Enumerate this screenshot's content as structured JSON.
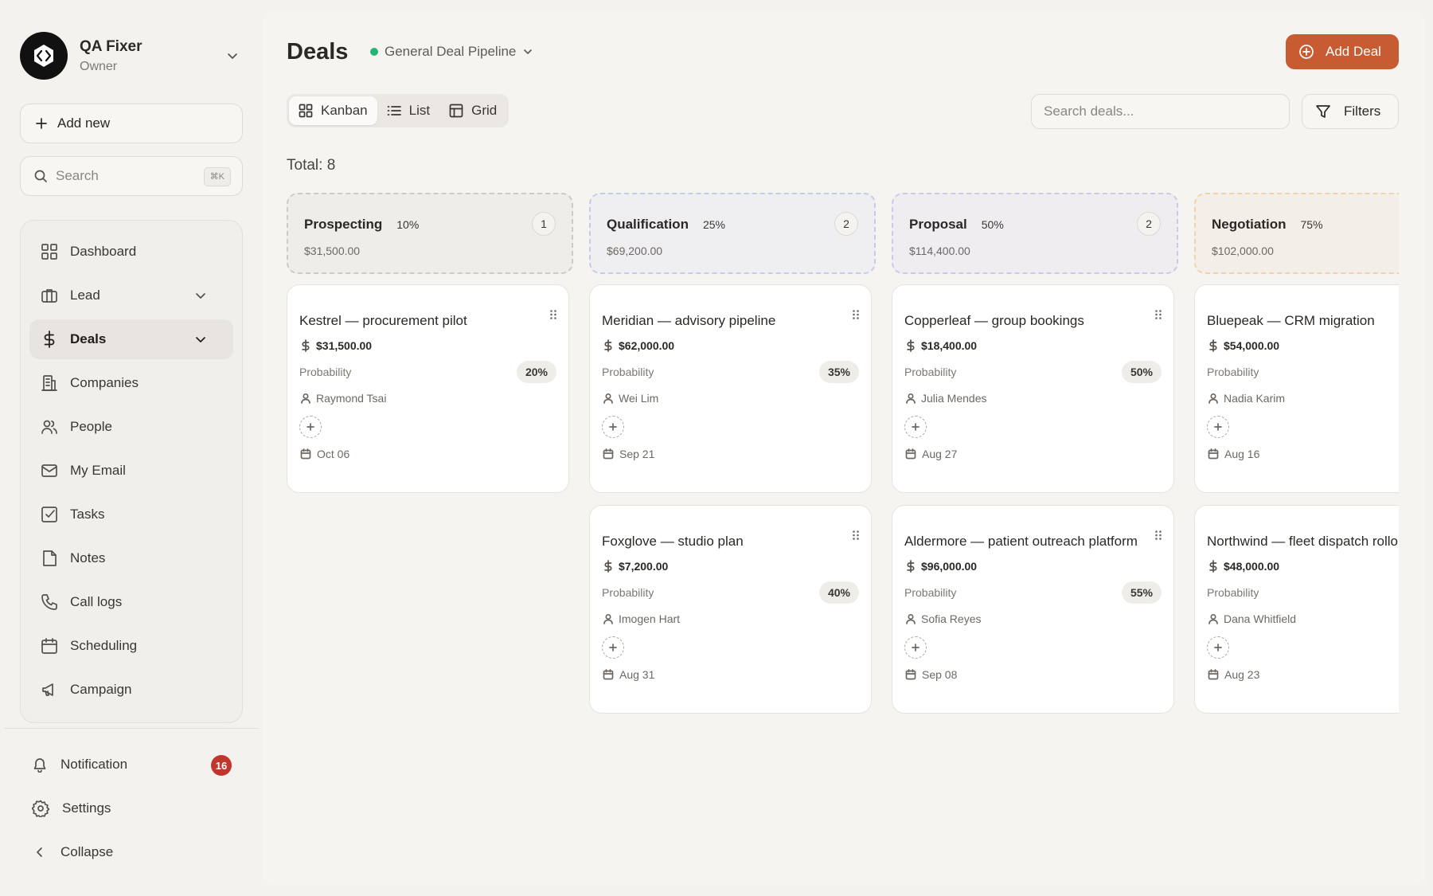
{
  "profile": {
    "name": "QA Fixer",
    "role": "Owner"
  },
  "sidebar": {
    "add_new": "Add new",
    "search_placeholder": "Search",
    "search_shortcut": "⌘K",
    "items": [
      {
        "label": "Dashboard",
        "icon": "grid-icon"
      },
      {
        "label": "Lead",
        "icon": "briefcase-icon"
      },
      {
        "label": "Deals",
        "icon": "dollar-icon"
      },
      {
        "label": "Companies",
        "icon": "building-icon"
      },
      {
        "label": "People",
        "icon": "users-icon"
      },
      {
        "label": "My Email",
        "icon": "mail-icon"
      },
      {
        "label": "Tasks",
        "icon": "checkbox-icon"
      },
      {
        "label": "Notes",
        "icon": "note-icon"
      },
      {
        "label": "Call logs",
        "icon": "phone-icon"
      },
      {
        "label": "Scheduling",
        "icon": "calendar-icon"
      },
      {
        "label": "Campaign",
        "icon": "megaphone-icon"
      }
    ],
    "bottom": {
      "notification": "Notification",
      "notification_count": "16",
      "settings": "Settings",
      "collapse": "Collapse"
    }
  },
  "header": {
    "title": "Deals",
    "pipeline": "General Deal Pipeline",
    "add_deal": "Add Deal"
  },
  "toolbar": {
    "views": [
      "Kanban",
      "List",
      "Grid"
    ],
    "active_view": "Kanban",
    "search_placeholder": "Search deals...",
    "filters": "Filters"
  },
  "total": "Total: 8",
  "accent_color": "#c75b32",
  "columns": [
    {
      "name": "Prospecting",
      "percent": "10%",
      "count": "1",
      "amount": "$31,500.00",
      "border": "#cfcac4",
      "bg": "#efedea",
      "cards": [
        {
          "title": "Kestrel — procurement pilot",
          "value": "$31,500.00",
          "probability_label": "Probability",
          "probability": "20%",
          "owner": "Raymond Tsai",
          "date": "Oct 06"
        }
      ]
    },
    {
      "name": "Qualification",
      "percent": "25%",
      "count": "2",
      "amount": "$69,200.00",
      "border": "#c3cdea",
      "bg": "#efeff1",
      "cards": [
        {
          "title": "Meridian — advisory pipeline",
          "value": "$62,000.00",
          "probability_label": "Probability",
          "probability": "35%",
          "owner": "Wei Lim",
          "date": "Sep 21"
        },
        {
          "title": "Foxglove — studio plan",
          "value": "$7,200.00",
          "probability_label": "Probability",
          "probability": "40%",
          "owner": "Imogen Hart",
          "date": "Aug 31"
        }
      ]
    },
    {
      "name": "Proposal",
      "percent": "50%",
      "count": "2",
      "amount": "$114,400.00",
      "border": "#d6c5ea",
      "bg": "#f0edf0",
      "cards": [
        {
          "title": "Copperleaf — group bookings",
          "value": "$18,400.00",
          "probability_label": "Probability",
          "probability": "50%",
          "owner": "Julia Mendes",
          "date": "Aug 27"
        },
        {
          "title": "Aldermore — patient outreach platform",
          "value": "$96,000.00",
          "probability_label": "Probability",
          "probability": "55%",
          "owner": "Sofia Reyes",
          "date": "Sep 08"
        }
      ]
    },
    {
      "name": "Negotiation",
      "percent": "75%",
      "count": "",
      "amount": "$102,000.00",
      "border": "#f2d3a8",
      "bg": "#f3eee8",
      "cards": [
        {
          "title": "Bluepeak — CRM migration",
          "value": "$54,000.00",
          "probability_label": "Probability",
          "probability": "",
          "owner": "Nadia Karim",
          "date": "Aug 16"
        },
        {
          "title": "Northwind — fleet dispatch rollout",
          "value": "$48,000.00",
          "probability_label": "Probability",
          "probability": "",
          "owner": "Dana Whitfield",
          "date": "Aug 23"
        }
      ]
    }
  ]
}
